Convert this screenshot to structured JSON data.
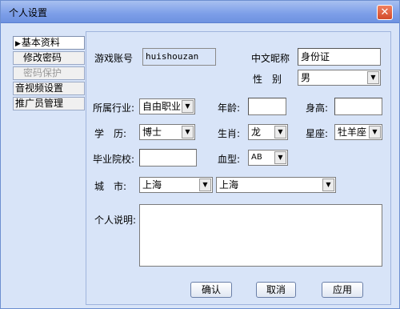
{
  "window": {
    "title": "个人设置",
    "close_glyph": "✕"
  },
  "sidebar": {
    "items": [
      {
        "label": "基本资料",
        "active": true
      },
      {
        "label": "修改密码"
      },
      {
        "label": "密码保护",
        "disabled": true
      },
      {
        "label": "音视频设置"
      },
      {
        "label": "推广员管理"
      }
    ]
  },
  "form": {
    "account_label": "游戏账号",
    "account_value": "huishouzan",
    "nickname_label": "中文昵称",
    "nickname_value": "身份证",
    "gender_label": "性　别",
    "gender_value": "男",
    "industry_label": "所属行业:",
    "industry_value": "自由职业",
    "age_label": "年龄:",
    "height_label": "身高:",
    "education_label": "学　历:",
    "education_value": "博士",
    "zodiac_label": "生肖:",
    "zodiac_value": "龙",
    "star_label": "星座:",
    "star_value": "牡羊座",
    "school_label": "毕业院校:",
    "blood_label": "血型:",
    "blood_value": "AB",
    "city_label": "城　市:",
    "province_value": "上海",
    "city_value": "上海",
    "description_label": "个人说明:"
  },
  "buttons": {
    "confirm": "确认",
    "cancel": "取消",
    "apply": "应用"
  },
  "dropdown_arrow": "▼"
}
